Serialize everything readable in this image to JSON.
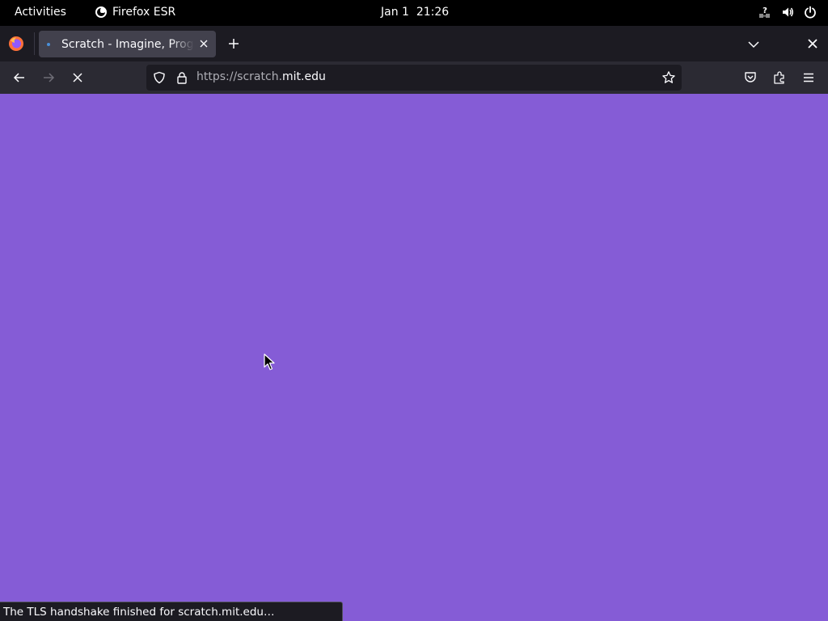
{
  "topbar": {
    "activities": "Activities",
    "app_name": "Firefox ESR",
    "date": "Jan 1",
    "time": "21:26",
    "icons": [
      "network-unknown-icon",
      "volume-icon",
      "power-icon"
    ]
  },
  "browser": {
    "tab": {
      "title": "Scratch - Imagine, Program, Share",
      "favicon": "scratch-favicon-loading"
    },
    "url": {
      "prefix": "https://scratch.",
      "domain": "mit.edu"
    },
    "status_text": "The TLS handshake finished for scratch.mit.edu…"
  },
  "colors": {
    "page_background": "#855cd6",
    "chrome_dark": "#1c1b22",
    "toolbar": "#2b2a33",
    "tab_active": "#42414d"
  }
}
